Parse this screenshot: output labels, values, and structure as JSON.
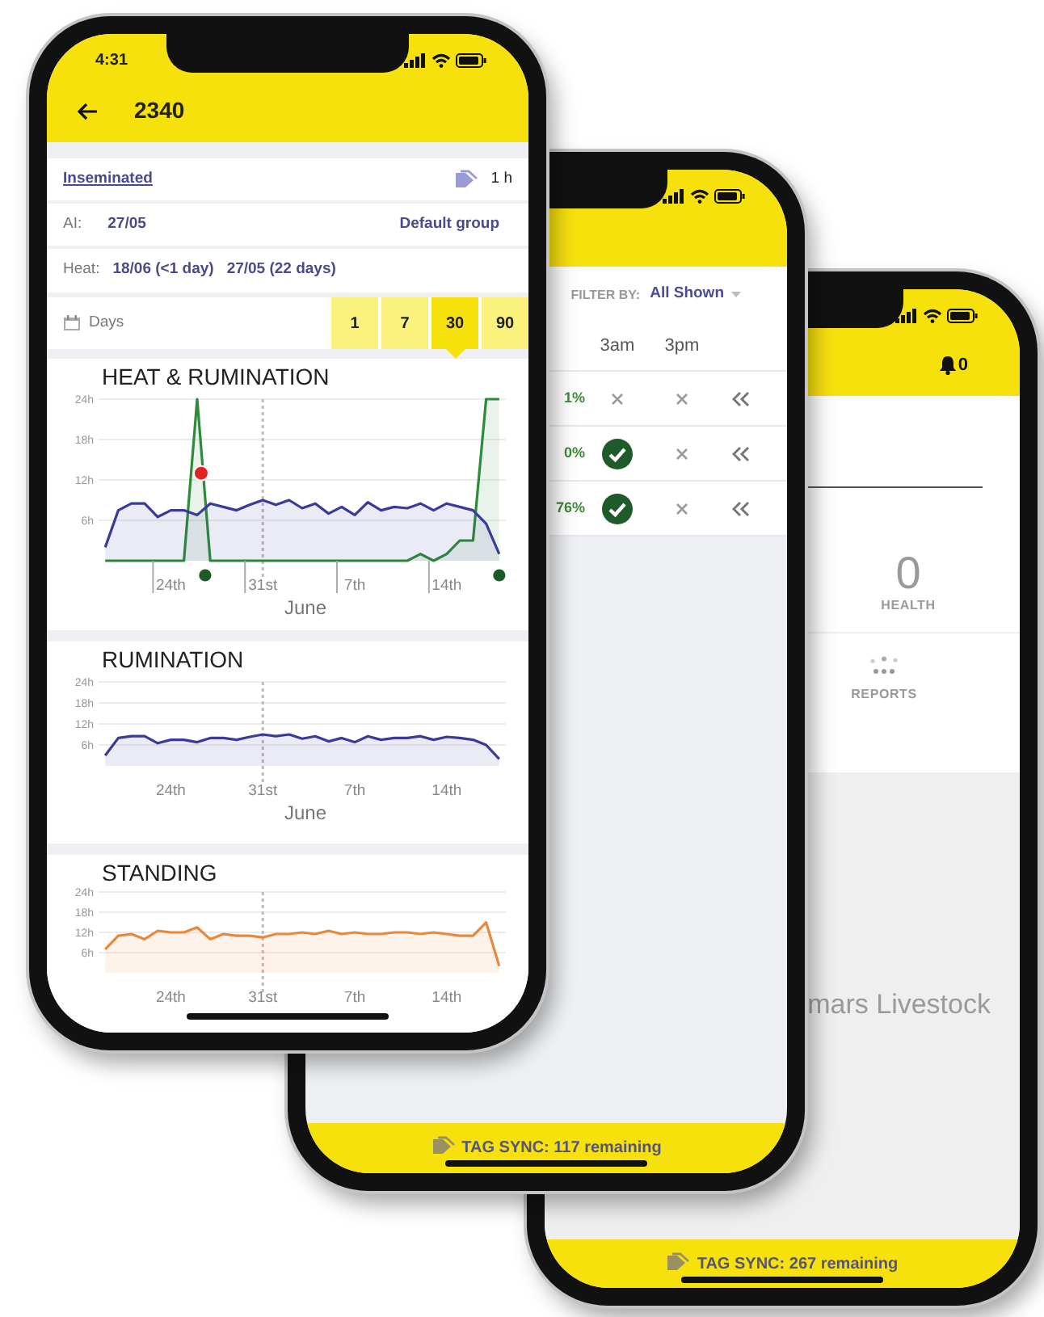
{
  "phones": [
    {
      "kind": "detail",
      "status_bar": {
        "time": "4:31"
      },
      "header": {
        "title": "2340"
      },
      "status": {
        "label": "Inseminated",
        "tag_time": "1 h"
      },
      "ai": {
        "label": "AI:",
        "date": "27/05",
        "group": "Default group"
      },
      "heat": {
        "label": "Heat:",
        "values": [
          "18/06 (<1 day)",
          "27/05 (22 days)"
        ]
      },
      "range": {
        "label": "Days",
        "options": [
          {
            "label": "1",
            "selected": false
          },
          {
            "label": "7",
            "selected": false
          },
          {
            "label": "30",
            "selected": true
          },
          {
            "label": "90",
            "selected": false
          }
        ]
      },
      "charts": [
        {
          "title": "HEAT & RUMINATION",
          "tick_marks": true,
          "event_markers": true,
          "chart_data": {
            "type": "area",
            "grid": true,
            "xlabel": "June",
            "categories": [
              null,
              null,
              null,
              null,
              null,
              "24th",
              null,
              null,
              null,
              null,
              null,
              null,
              "31st",
              null,
              null,
              null,
              null,
              null,
              null,
              "7th",
              null,
              null,
              null,
              null,
              null,
              null,
              "14th",
              null,
              null,
              null,
              null
            ],
            "ylim": [
              0,
              24
            ],
            "yticks": [
              {
                "value": 6,
                "label": "6h"
              },
              {
                "value": 12,
                "label": "12h"
              },
              {
                "value": 18,
                "label": "18h"
              },
              {
                "value": 24,
                "label": "24h"
              }
            ],
            "series": [
              {
                "color": "#2e8b3a",
                "values": [
                  0,
                  0,
                  0,
                  0,
                  0,
                  0,
                  0,
                  24,
                  0,
                  0,
                  0,
                  0,
                  0,
                  0,
                  0,
                  0,
                  0,
                  0,
                  0,
                  0,
                  0,
                  0,
                  0,
                  0,
                  1,
                  0,
                  1,
                  3,
                  3,
                  24,
                  24
                ]
              },
              {
                "color": "#3a3a9a",
                "values": [
                  2,
                  7.5,
                  8.5,
                  8.5,
                  6.5,
                  7.5,
                  7.5,
                  6.8,
                  8.5,
                  8,
                  7.5,
                  8.3,
                  9,
                  8.3,
                  9,
                  7.8,
                  8.5,
                  7,
                  8,
                  6.8,
                  8.7,
                  7.5,
                  8,
                  7.8,
                  8.5,
                  7.5,
                  8.5,
                  8,
                  7.5,
                  5.5,
                  1
                ]
              }
            ]
          }
        },
        {
          "title": "RUMINATION",
          "chart_data": {
            "type": "area",
            "grid": true,
            "xlabel": "June",
            "categories": [
              null,
              null,
              null,
              null,
              null,
              "24th",
              null,
              null,
              null,
              null,
              null,
              null,
              "31st",
              null,
              null,
              null,
              null,
              null,
              null,
              "7th",
              null,
              null,
              null,
              null,
              null,
              null,
              "14th",
              null,
              null,
              null,
              null
            ],
            "ylim": [
              0,
              24
            ],
            "yticks": [
              {
                "value": 6,
                "label": "6h"
              },
              {
                "value": 12,
                "label": "12h"
              },
              {
                "value": 18,
                "label": "18h"
              },
              {
                "value": 24,
                "label": "24h"
              }
            ],
            "series": [
              {
                "color": "#3a3a9a",
                "values": [
                  3,
                  8,
                  8.5,
                  8.5,
                  6.5,
                  7.5,
                  7.5,
                  6.8,
                  8,
                  8,
                  7.5,
                  8.3,
                  9,
                  8.5,
                  9,
                  7.8,
                  8.5,
                  7,
                  8,
                  6.8,
                  8.5,
                  7.5,
                  8,
                  8,
                  8.5,
                  7.5,
                  8.3,
                  8,
                  7.5,
                  6,
                  2
                ]
              }
            ]
          }
        },
        {
          "title": "STANDING",
          "chart_data": {
            "type": "area",
            "grid": true,
            "categories": [
              null,
              null,
              null,
              null,
              null,
              "24th",
              null,
              null,
              null,
              null,
              null,
              null,
              "31st",
              null,
              null,
              null,
              null,
              null,
              null,
              "7th",
              null,
              null,
              null,
              null,
              null,
              null,
              "14th",
              null,
              null,
              null,
              null
            ],
            "ylim": [
              0,
              24
            ],
            "yticks": [
              {
                "value": 6,
                "label": "6h"
              },
              {
                "value": 12,
                "label": "12h"
              },
              {
                "value": 18,
                "label": "18h"
              },
              {
                "value": 24,
                "label": "24h"
              }
            ],
            "series": [
              {
                "color": "#e8883a",
                "values": [
                  7,
                  11,
                  11.5,
                  10,
                  12.5,
                  12,
                  12,
                  13.5,
                  10,
                  11.5,
                  11,
                  11,
                  10.5,
                  11.5,
                  11.5,
                  12,
                  11.5,
                  12.5,
                  11.5,
                  12,
                  11.5,
                  11.5,
                  12,
                  12,
                  11.5,
                  12,
                  11.5,
                  11,
                  11,
                  15,
                  2
                ]
              }
            ]
          }
        }
      ]
    },
    {
      "kind": "list",
      "filter": {
        "label": "FILTER BY:",
        "value": "All Shown"
      },
      "columns": [
        "3am",
        "3pm"
      ],
      "rows": [
        {
          "column_1": "1%",
          "cells": [
            {
              "checked": false
            },
            {
              "checked": false
            }
          ]
        },
        {
          "column_1": "0%",
          "cells": [
            {
              "checked": true
            },
            {
              "checked": false
            }
          ]
        },
        {
          "column_1": "76%",
          "cells": [
            {
              "checked": true
            },
            {
              "checked": false
            }
          ]
        }
      ],
      "footer": "TAG SYNC: 117 remaining"
    },
    {
      "kind": "home",
      "notifications": "0",
      "health": {
        "count": "0",
        "label": "HEALTH"
      },
      "reports": {
        "label": "REPORTS"
      },
      "brand": "mars Livestock",
      "footer": "TAG SYNC: 267 remaining"
    }
  ]
}
